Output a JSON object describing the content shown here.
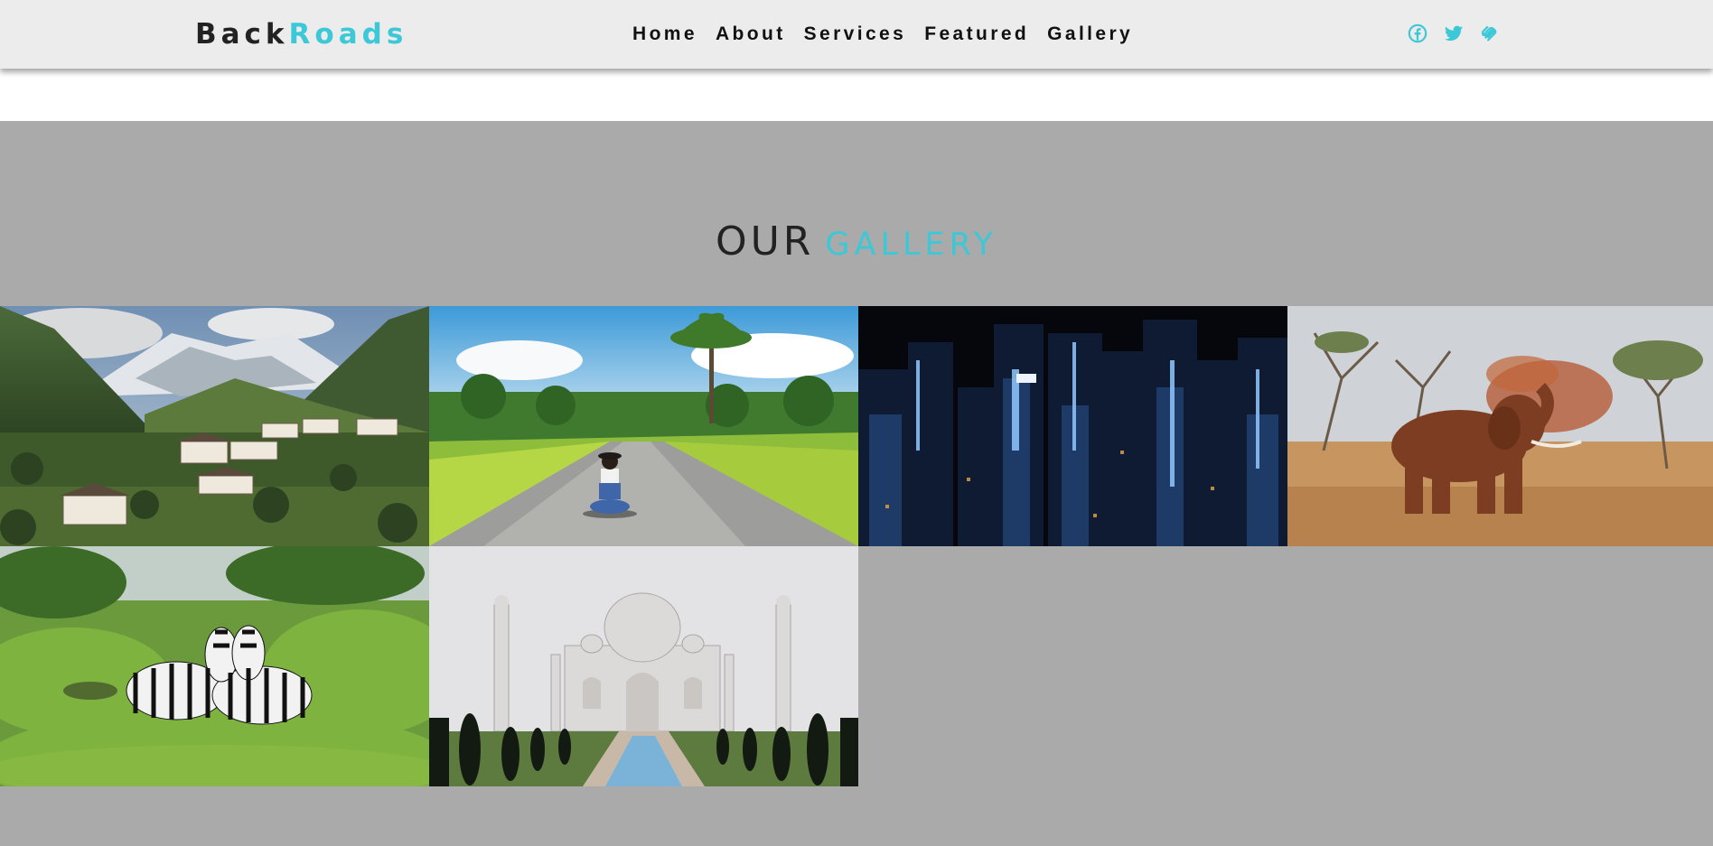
{
  "brand": {
    "part1": "Back",
    "part2": "Roads"
  },
  "nav": {
    "items": [
      "Home",
      "About",
      "Services",
      "Featured",
      "Gallery"
    ]
  },
  "social": {
    "icons": [
      "facebook-icon",
      "twitter-icon",
      "squarespace-icon"
    ],
    "accent": "#3cc8d6"
  },
  "gallery": {
    "title_main": "OUR",
    "title_accent": "GALLERY",
    "images": [
      {
        "name": "mountain-village-photo"
      },
      {
        "name": "tropical-road-photo"
      },
      {
        "name": "city-night-photo"
      },
      {
        "name": "elephant-savanna-photo"
      },
      {
        "name": "zebras-photo"
      },
      {
        "name": "taj-mahal-photo"
      }
    ]
  },
  "colors": {
    "accent": "#3cc8d6",
    "navbar_bg": "#ececec",
    "gallery_bg": "#aaaaaa",
    "text_dark": "#222222"
  }
}
